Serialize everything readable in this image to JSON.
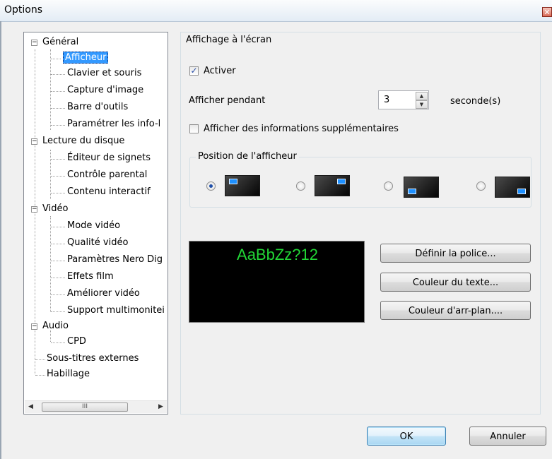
{
  "window": {
    "title": "Options",
    "close_glyph": "✕"
  },
  "tree": {
    "items": [
      {
        "label": "Général",
        "level": 0,
        "expanded": true
      },
      {
        "label": "Afficheur",
        "level": 1,
        "selected": true
      },
      {
        "label": "Clavier et souris",
        "level": 1
      },
      {
        "label": "Capture d'image",
        "level": 1
      },
      {
        "label": "Barre d'outils",
        "level": 1
      },
      {
        "label": "Paramétrer les info-l",
        "level": 1
      },
      {
        "label": "Lecture du disque",
        "level": 0,
        "expanded": true
      },
      {
        "label": "Éditeur de signets",
        "level": 1
      },
      {
        "label": "Contrôle parental",
        "level": 1
      },
      {
        "label": "Contenu interactif",
        "level": 1
      },
      {
        "label": "Vidéo",
        "level": 0,
        "expanded": true
      },
      {
        "label": "Mode vidéo",
        "level": 1
      },
      {
        "label": "Qualité vidéo",
        "level": 1
      },
      {
        "label": "Paramètres Nero Dig",
        "level": 1
      },
      {
        "label": "Effets film",
        "level": 1
      },
      {
        "label": "Améliorer vidéo",
        "level": 1
      },
      {
        "label": "Support multimonitei",
        "level": 1
      },
      {
        "label": "Audio",
        "level": 0,
        "expanded": true
      },
      {
        "label": "CPD",
        "level": 1
      },
      {
        "label": "Sous-titres externes",
        "level": 0
      },
      {
        "label": "Habillage",
        "level": 0
      }
    ],
    "expander_glyph": "−",
    "scroll_left": "◀",
    "scroll_right": "▶",
    "scroll_grip": "III"
  },
  "osd": {
    "group_title": "Affichage à l'écran",
    "enable_label": "Activer",
    "enable_checked": true,
    "duration_label": "Afficher pendant",
    "duration_value": "3",
    "duration_unit": "seconde(s)",
    "extra_info_label": "Afficher des informations supplémentaires",
    "extra_info_checked": false,
    "check_glyph": "✓",
    "spin_up": "▲",
    "spin_down": "▼"
  },
  "position": {
    "group_title": "Position de l'afficheur",
    "selected_index": 0,
    "options": [
      {
        "icon": "screen-top-left-icon"
      },
      {
        "icon": "screen-top-right-icon"
      },
      {
        "icon": "screen-bottom-left-icon"
      },
      {
        "icon": "screen-bottom-right-icon"
      }
    ]
  },
  "preview": {
    "sample_text": "AaBbZz?12",
    "text_color": "#22d636",
    "background_color": "#000000"
  },
  "font_buttons": {
    "set_font": "Définir la police...",
    "text_color": "Couleur du texte...",
    "background_color": "Couleur d'arr-plan...."
  },
  "dialog_buttons": {
    "ok": "OK",
    "cancel": "Annuler"
  }
}
